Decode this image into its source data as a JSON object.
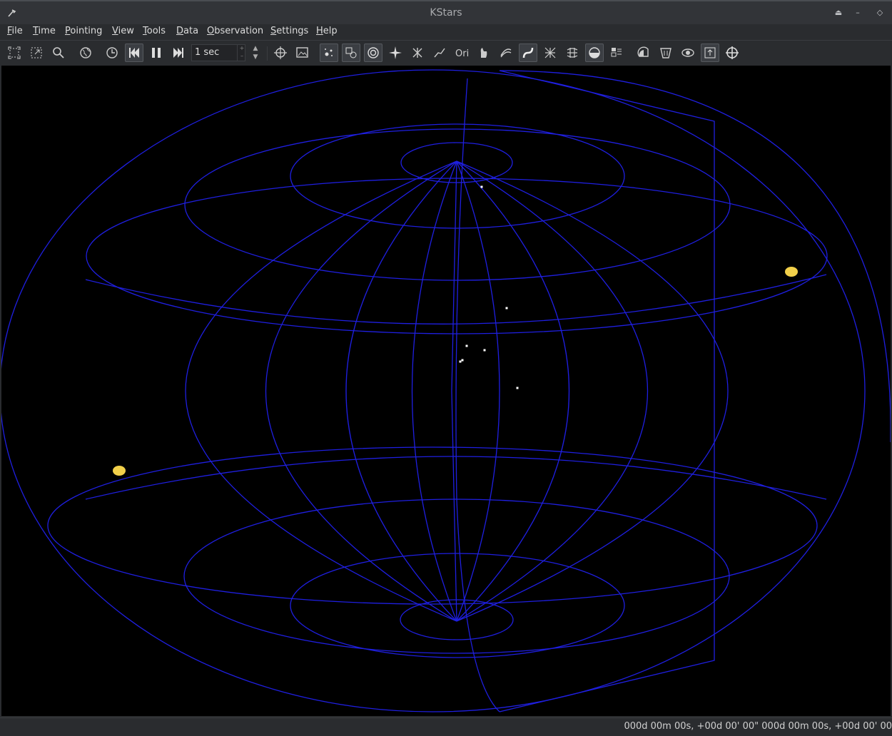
{
  "window": {
    "title": "KStars"
  },
  "menu": [
    {
      "label": "File"
    },
    {
      "label": "Time"
    },
    {
      "label": "Pointing"
    },
    {
      "label": "View"
    },
    {
      "label": "Tools"
    },
    {
      "label": "Data"
    },
    {
      "label": "Observation"
    },
    {
      "label": "Settings"
    },
    {
      "label": "Help"
    }
  ],
  "toolbar": {
    "time_step": "1 sec"
  },
  "status": {
    "text": "000d 00m 00s,   +00d 00' 00\"  000d 00m 00s,   +00d 00' 00"
  },
  "colors": {
    "grid": "#1f1fe0",
    "planet": "#f2d04a",
    "star": "#ffffff",
    "background": "#000000"
  }
}
